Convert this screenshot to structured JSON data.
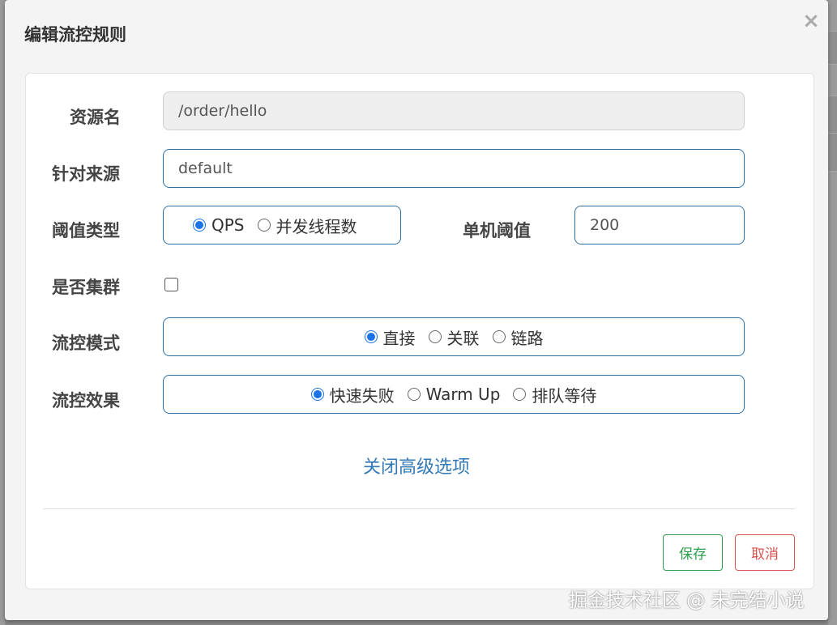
{
  "dialog": {
    "title": "编辑流控规则",
    "close_icon": "×"
  },
  "form": {
    "resource": {
      "label": "资源名",
      "value": "/order/hello"
    },
    "limit_app": {
      "label": "针对来源",
      "value": "default"
    },
    "grade": {
      "label": "阈值类型",
      "options": [
        "QPS",
        "并发线程数"
      ],
      "selected": "QPS"
    },
    "count": {
      "label": "单机阈值",
      "value": "200"
    },
    "cluster": {
      "label": "是否集群",
      "checked": false
    },
    "strategy": {
      "label": "流控模式",
      "options": [
        "直接",
        "关联",
        "链路"
      ],
      "selected": "直接"
    },
    "control_behavior": {
      "label": "流控效果",
      "options": [
        "快速失败",
        "Warm Up",
        "排队等待"
      ],
      "selected": "快速失败"
    },
    "advanced_link": "关闭高级选项"
  },
  "footer": {
    "save_label": "保存",
    "cancel_label": "取消"
  },
  "watermark": "掘金技术社区 @ 未完结小说",
  "colors": {
    "accent": "#1a73e8",
    "border": "#2c6fa5",
    "save": "#2e9e4c",
    "cancel": "#d9534f",
    "link": "#337ab7"
  }
}
